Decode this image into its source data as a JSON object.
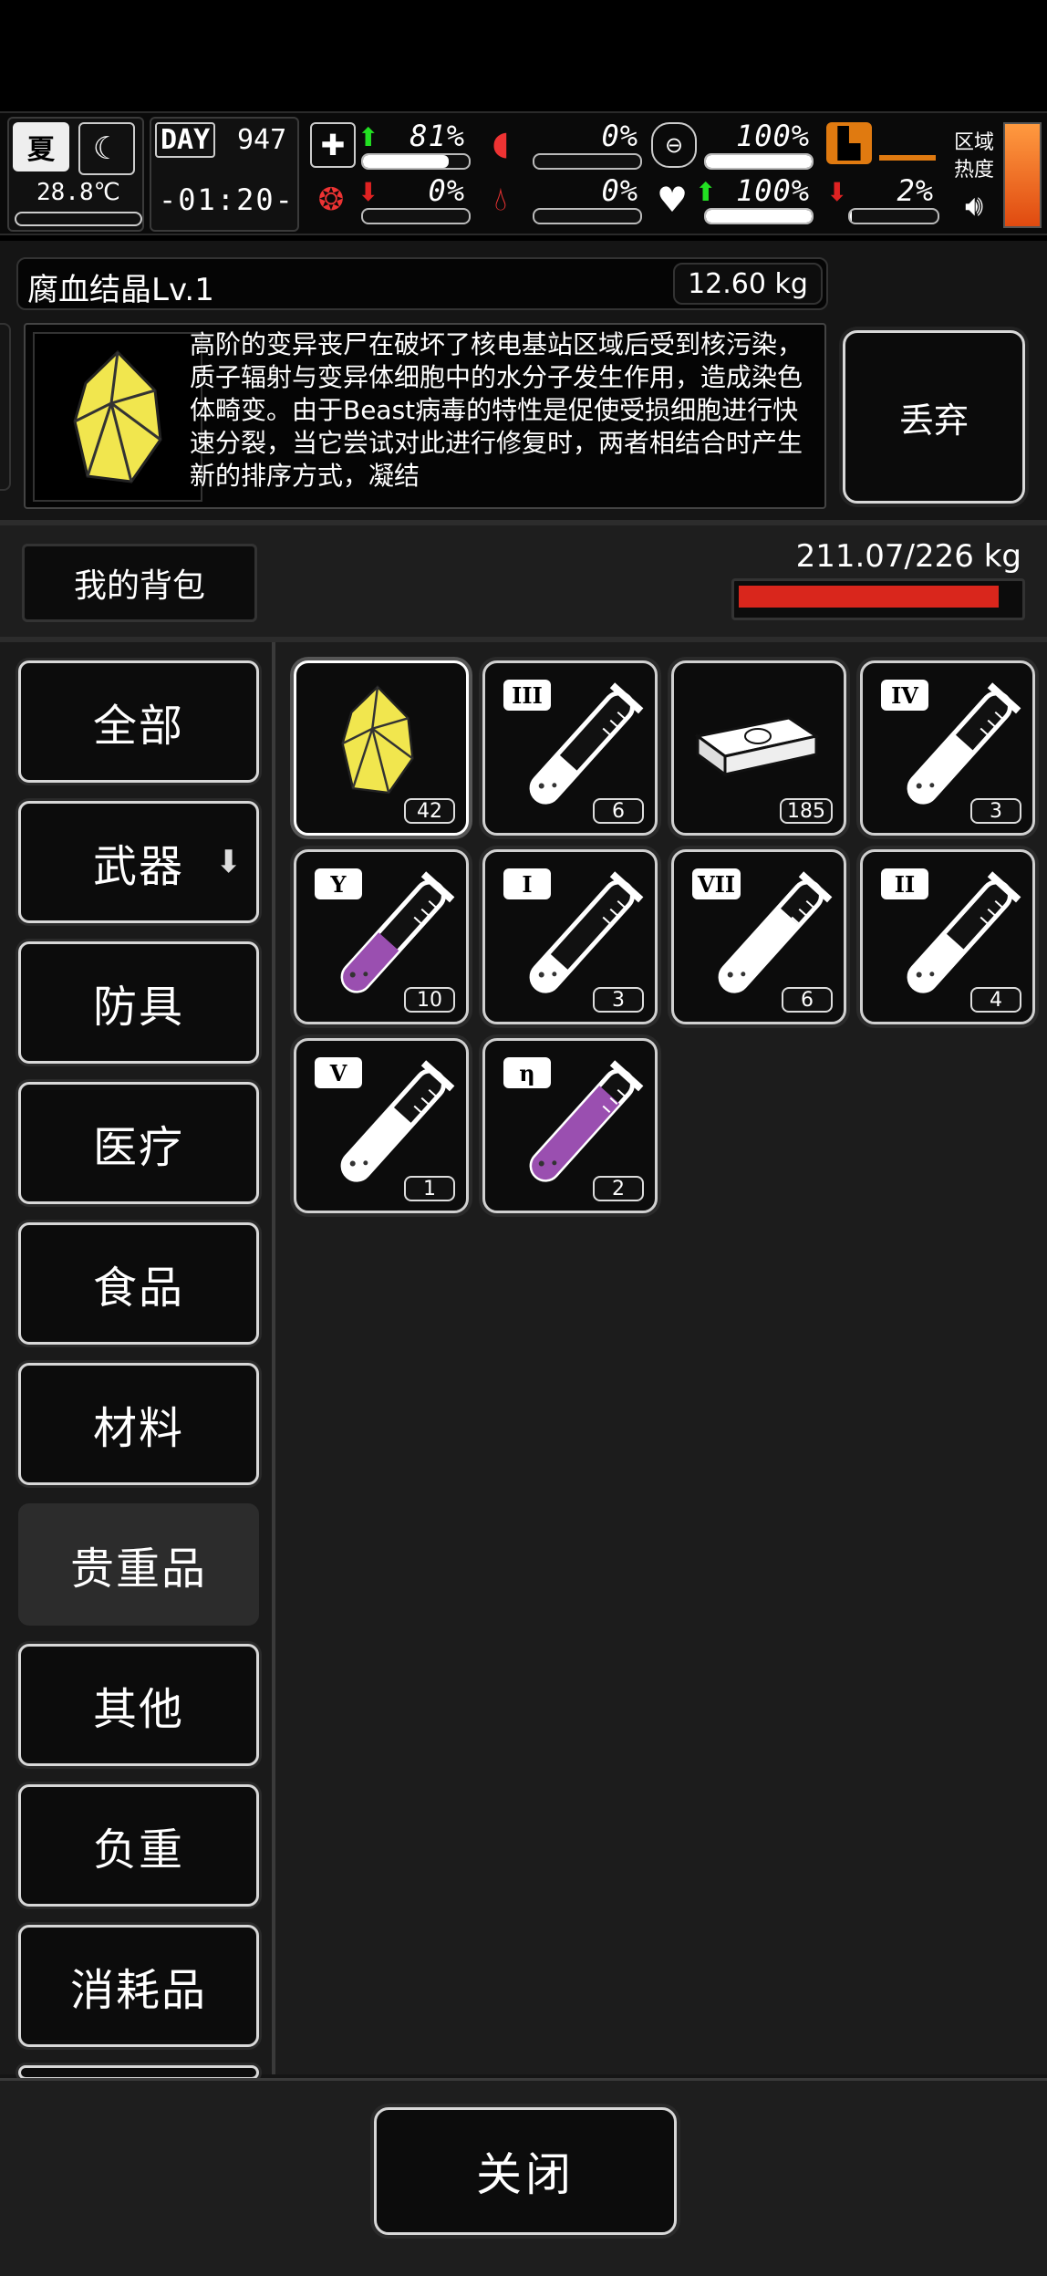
{
  "hud": {
    "season": "夏",
    "temperature": "28.8℃",
    "day_label": "DAY",
    "day_number": "947",
    "clock": "-01:20-",
    "stats": [
      {
        "name": "health",
        "value": "81%",
        "fill": 0.81,
        "trend": "up"
      },
      {
        "name": "hunger",
        "value": "0%",
        "fill": 0.0,
        "trend": "none"
      },
      {
        "name": "stamina",
        "value": "100%",
        "fill": 1.0,
        "trend": "none"
      },
      {
        "name": "brain",
        "value": "0%",
        "fill": 0.0,
        "trend": "down"
      },
      {
        "name": "thirst",
        "value": "0%",
        "fill": 0.0,
        "trend": "none"
      },
      {
        "name": "mood",
        "value": "100%",
        "fill": 1.0,
        "trend": "up"
      },
      {
        "name": "fatigue",
        "value": "2%",
        "fill": 0.02,
        "trend": "down"
      }
    ],
    "region_heat_label_1": "区域",
    "region_heat_label_2": "热度",
    "region_heat_color": "#e04a10"
  },
  "item_detail": {
    "name": "腐血结晶Lv.1",
    "weight": "12.60 kg",
    "icon": "yellow-crystal-icon",
    "description": "高阶的变异丧尸在破坏了核电基站区域后受到核污染，质子辐射与变异体细胞中的水分子发生作用，造成染色体畸变。由于Beast病毒的特性是促使受损细胞进行快速分裂，当它尝试对此进行修复时，两者相结合时产生新的排序方式，凝结",
    "drop_label": "丢弃"
  },
  "bag": {
    "title": "我的背包",
    "capacity": "211.07/226 kg",
    "capacity_fraction": 0.934,
    "capacity_color": "#d9261c"
  },
  "categories": [
    {
      "label": "全部"
    },
    {
      "label": "武器",
      "has_arrow": true
    },
    {
      "label": "防具"
    },
    {
      "label": "医疗"
    },
    {
      "label": "食品"
    },
    {
      "label": "材料"
    },
    {
      "label": "贵重品",
      "active": true
    },
    {
      "label": "其他"
    },
    {
      "label": "负重"
    },
    {
      "label": "消耗品"
    }
  ],
  "items": [
    {
      "type": "crystal",
      "count": "42",
      "selected": true
    },
    {
      "type": "tube",
      "roman": "III",
      "count": "6",
      "liquid": "#ffffff",
      "level": 0.35
    },
    {
      "type": "cash",
      "count": "185"
    },
    {
      "type": "tube",
      "roman": "IV",
      "count": "3",
      "liquid": "#ffffff",
      "level": 0.55
    },
    {
      "type": "tube",
      "roman": "Y",
      "count": "10",
      "liquid": "#9a4fb0",
      "level": 0.45
    },
    {
      "type": "tube",
      "roman": "I",
      "count": "3",
      "liquid": "#ffffff",
      "level": 0.25
    },
    {
      "type": "tube",
      "roman": "VII",
      "count": "6",
      "liquid": "#ffffff",
      "level": 0.7
    },
    {
      "type": "tube",
      "roman": "II",
      "count": "4",
      "liquid": "#ffffff",
      "level": 0.45
    },
    {
      "type": "tube",
      "roman": "V",
      "count": "1",
      "liquid": "#ffffff",
      "level": 0.6
    },
    {
      "type": "tube",
      "roman": "η",
      "count": "2",
      "liquid": "#9a4fb0",
      "level": 0.8
    }
  ],
  "footer": {
    "close_label": "关闭"
  }
}
